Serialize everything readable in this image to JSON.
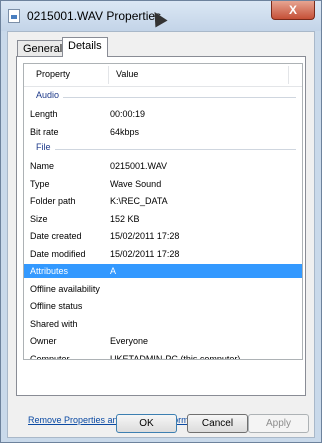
{
  "window": {
    "title": "0215001.WAV Properties",
    "close_label": "X",
    "icon": "wav-file-icon"
  },
  "tabs": [
    {
      "label": "General",
      "selected": false
    },
    {
      "label": "Details",
      "selected": true
    }
  ],
  "columns": {
    "property": "Property",
    "value": "Value"
  },
  "groups": {
    "audio": "Audio",
    "file": "File"
  },
  "audio_rows": [
    {
      "name": "Length",
      "value": "00:00:19"
    },
    {
      "name": "Bit rate",
      "value": "64kbps"
    }
  ],
  "file_rows": [
    {
      "name": "Name",
      "value": "0215001.WAV"
    },
    {
      "name": "Type",
      "value": "Wave Sound"
    },
    {
      "name": "Folder path",
      "value": "K:\\REC_DATA"
    },
    {
      "name": "Size",
      "value": "152 KB"
    },
    {
      "name": "Date created",
      "value": "15/02/2011 17:28"
    },
    {
      "name": "Date modified",
      "value": "15/02/2011 17:28"
    },
    {
      "name": "Attributes",
      "value": "A",
      "selected": true
    },
    {
      "name": "Offline availability",
      "value": ""
    },
    {
      "name": "Offline status",
      "value": ""
    },
    {
      "name": "Shared with",
      "value": ""
    },
    {
      "name": "Owner",
      "value": "Everyone"
    },
    {
      "name": "Computer",
      "value": "UKETADMIN-PC (this computer)"
    }
  ],
  "link_text": "Remove Properties and Personal Information",
  "buttons": {
    "ok": "OK",
    "cancel": "Cancel",
    "apply": "Apply"
  },
  "colors": {
    "selection": "#3399ff",
    "link": "#0b4aa3",
    "group_header": "#1e3a8a"
  }
}
